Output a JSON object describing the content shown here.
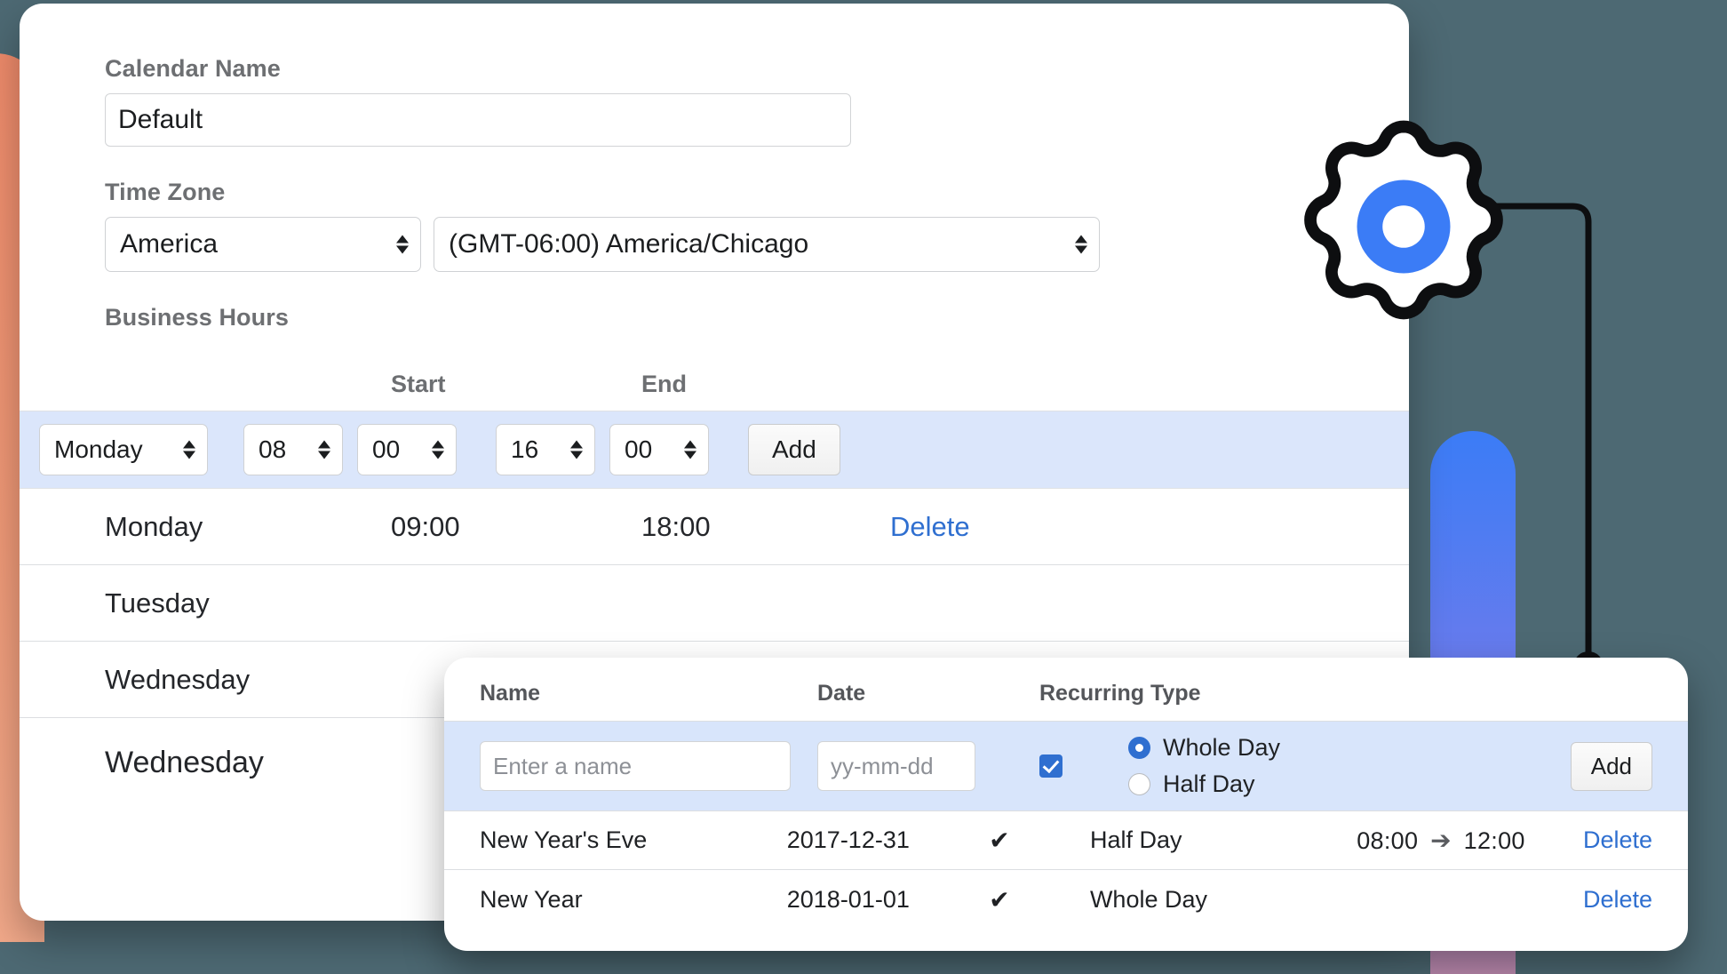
{
  "colors": {
    "background": "#4d6973",
    "accent_blue": "#3b7cf6",
    "link_blue": "#2f6fd0",
    "row_highlight": "#dbe6fb",
    "blob_left": "#ef8b6b"
  },
  "icons": {
    "gear": "gear-icon",
    "connector": "connector-line",
    "stepper": "stepper-arrows-icon",
    "check": "check-icon",
    "arrow_right": "arrow-right-icon"
  },
  "calendar": {
    "name_label": "Calendar Name",
    "name_value": "Default",
    "name_placeholder": "Calendar Name",
    "timezone_label": "Time Zone",
    "timezone_area": "America",
    "timezone_zone": "(GMT-06:00) America/Chicago"
  },
  "business_hours": {
    "section_label": "Business Hours",
    "columns": {
      "day": "",
      "start": "Start",
      "end": "End"
    },
    "editor": {
      "day": "Monday",
      "start_hour": "08",
      "start_minute": "00",
      "end_hour": "16",
      "end_minute": "00",
      "add_label": "Add"
    },
    "rows": [
      {
        "day": "Monday",
        "start": "09:00",
        "end": "18:00",
        "action": "Delete"
      },
      {
        "day": "Tuesday",
        "start": "",
        "end": "",
        "action": ""
      },
      {
        "day": "Wednesday",
        "start": "",
        "end": "",
        "action": ""
      },
      {
        "day": "Wednesday",
        "start": "",
        "end": "",
        "action": ""
      }
    ]
  },
  "holidays": {
    "columns": {
      "name": "Name",
      "date": "Date",
      "recurring": "Recurring",
      "type": "Type"
    },
    "editor": {
      "name_placeholder": "Enter a name",
      "name_value": "",
      "date_placeholder": "yy-mm-dd",
      "date_value": "",
      "recurring_checked": true,
      "type_options": [
        "Whole Day",
        "Half Day"
      ],
      "type_selected": "Whole Day",
      "add_label": "Add"
    },
    "rows": [
      {
        "name": "New Year's Eve",
        "date": "2017-12-31",
        "recurring": "✔",
        "type": "Half Day",
        "time_start": "08:00",
        "time_end": "12:00",
        "action": "Delete"
      },
      {
        "name": "New Year",
        "date": "2018-01-01",
        "recurring": "✔",
        "type": "Whole Day",
        "time_start": "",
        "time_end": "",
        "action": "Delete"
      }
    ]
  }
}
